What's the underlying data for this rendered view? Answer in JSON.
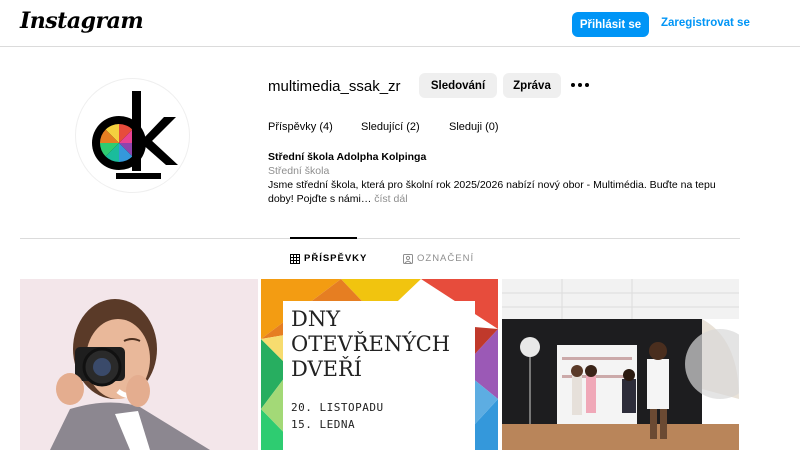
{
  "header": {
    "logo_text": "Instagram",
    "login_label": "Přihlásit se",
    "signup_label": "Zaregistrovat se"
  },
  "profile": {
    "username": "multimedia_ssak_zr",
    "follow_label": "Sledování",
    "message_label": "Zpráva",
    "stats": {
      "posts": "Příspěvky (4)",
      "followers": "Sledující (2)",
      "following": "Sleduji (0)"
    },
    "bio": {
      "name": "Střední škola Adolpha Kolpinga",
      "category": "Střední škola",
      "text": "Jsme střední škola, která pro školní rok 2025/2026 nabízí nový obor - Multimédia. Buďte na tepu doby! Pojďte s námi…",
      "more_label": "číst dál"
    }
  },
  "tabs": {
    "posts_label": "PŘÍSPĚVKY",
    "tagged_label": "OZNAČENÍ"
  },
  "posts": {
    "poster": {
      "title_line1": "DNY",
      "title_line2": "OTEVŘENÝCH",
      "title_line3": "DVEŘÍ",
      "date1": "20. LISTOPADU",
      "date2": "15. LEDNA"
    }
  },
  "colors": {
    "primary_button": "#0095f6",
    "secondary_button": "#efefef",
    "border": "#dbdbdb",
    "muted_text": "#8e8e8e"
  }
}
